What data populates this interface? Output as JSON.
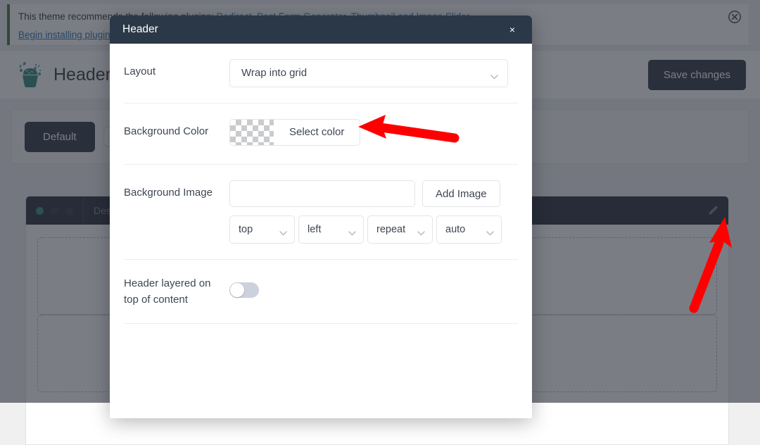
{
  "notice": {
    "line1": "This theme recommends the following plugins: Redirect, Post Form Generator, Thumbnail and Image Slider",
    "line1_prefix": "This theme recommends the following plugins: ",
    "link_text": "Redirect, Post Form Generator, Thumbnail and Image Slider",
    "line2_link": "Begin installing plugins",
    "dismiss_icon": "close-circle-icon"
  },
  "app": {
    "logo_icon": "cupcake-logo-icon",
    "title": "Header Builder",
    "save_label": "Save changes"
  },
  "tabs": [
    {
      "label": "Default",
      "active": true
    },
    {
      "label": "",
      "active": false
    }
  ],
  "canvas": {
    "dots": [
      {
        "name": "desktop-dot",
        "active": true
      },
      {
        "name": "tablet-dot",
        "active": false
      },
      {
        "name": "mobile-dot",
        "active": false
      }
    ],
    "device_label": "Desktop",
    "edit_icon": "pencil-icon",
    "dropzones": 2
  },
  "modal": {
    "title": "Header",
    "close_label": "×",
    "close_icon": "close-icon",
    "fields": {
      "layout": {
        "label": "Layout",
        "value": "Wrap into grid",
        "icon": "chevron-down-icon"
      },
      "background_color": {
        "label": "Background Color",
        "button_label": "Select color",
        "swatch": "transparent-checkerboard",
        "value": ""
      },
      "background_image": {
        "label": "Background Image",
        "input_value": "",
        "input_placeholder": "",
        "add_button_label": "Add Image",
        "position_y": "top",
        "position_x": "left",
        "repeat": "repeat",
        "size": "auto"
      },
      "layered": {
        "label_line1": "Header layered on",
        "label_line2": "top of content",
        "toggle_state": "off"
      }
    }
  },
  "annotations": {
    "arrow_color": "#ff0000",
    "arrow1_target": "select-color-button",
    "arrow2_target": "canvas-edit-pencil"
  }
}
